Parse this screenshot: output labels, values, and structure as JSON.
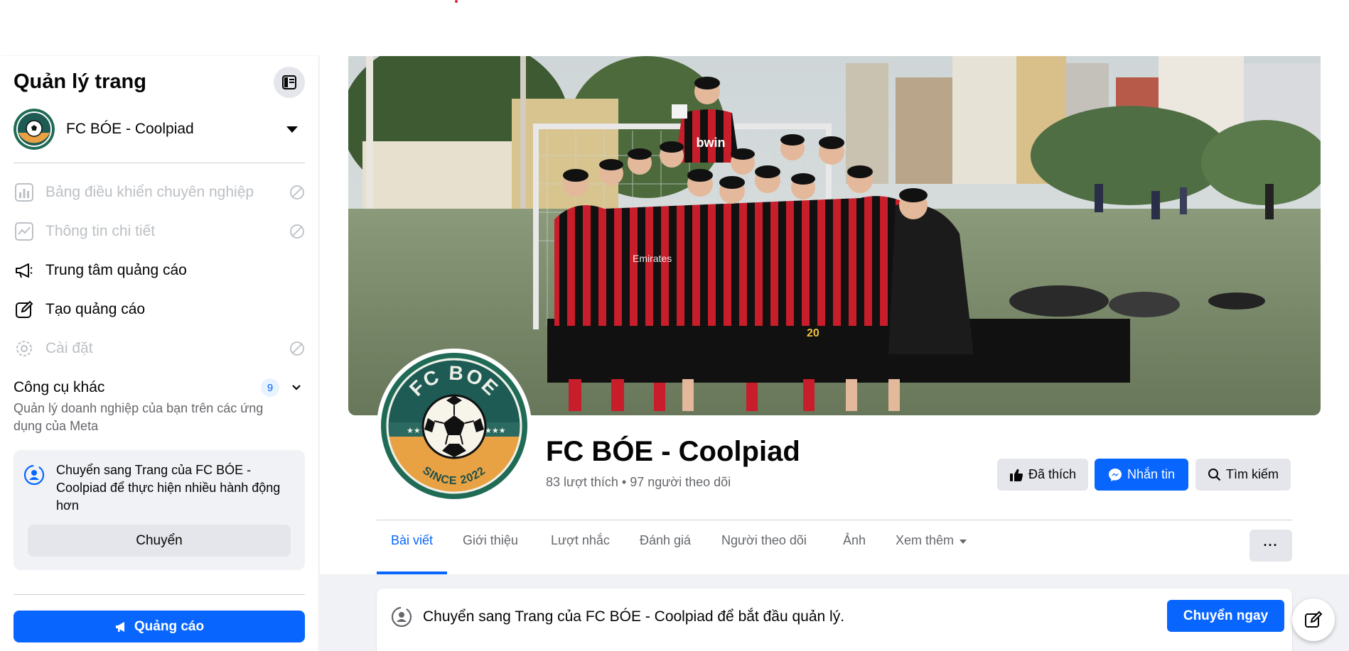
{
  "sidebar": {
    "title": "Quản lý trang",
    "page_name": "FC BÓE - Coolpiad",
    "menu": [
      {
        "label": "Bảng điều khiển chuyên nghiệp",
        "icon": "dashboard-icon",
        "disabled": true
      },
      {
        "label": "Thông tin chi tiết",
        "icon": "insights-icon",
        "disabled": true
      },
      {
        "label": "Trung tâm quảng cáo",
        "icon": "megaphone-icon",
        "disabled": false
      },
      {
        "label": "Tạo quảng cáo",
        "icon": "edit-icon",
        "disabled": false
      },
      {
        "label": "Cài đặt",
        "icon": "gear-icon",
        "disabled": true
      }
    ],
    "tools": {
      "title": "Công cụ khác",
      "badge": "9",
      "description": "Quản lý doanh nghiệp của bạn trên các ứng dụng của Meta"
    },
    "switch_card": {
      "text": "Chuyển sang Trang của FC BÓE - Coolpiad để thực hiện nhiều hành động hơn",
      "button": "Chuyển"
    },
    "ads_button": "Quảng cáo"
  },
  "profile": {
    "logo_top": "FC BOE",
    "logo_bottom": "SINCE 2022",
    "name": "FC BÓE - Coolpiad",
    "stats": "83 lượt thích • 97 người theo dõi",
    "buttons": {
      "liked": "Đã thích",
      "message": "Nhắn tin",
      "search": "Tìm kiếm"
    }
  },
  "cover": {
    "shirt_sponsor": "bwin",
    "shirt_text": "Emirates",
    "shirt_number": "20"
  },
  "tabs": [
    {
      "label": "Bài viết",
      "active": true
    },
    {
      "label": "Giới thiệu"
    },
    {
      "label": "Lượt nhắc"
    },
    {
      "label": "Đánh giá"
    },
    {
      "label": "Người theo dõi"
    },
    {
      "label": "Ảnh"
    },
    {
      "label": "Xem thêm",
      "dropdown": true
    }
  ],
  "more_button": "···",
  "banner": {
    "text": "Chuyển sang Trang của FC BÓE - Coolpiad để bắt đầu quản lý.",
    "button": "Chuyển ngay"
  },
  "colors": {
    "accent": "#0866ff",
    "disabled_text": "#bcc0c4",
    "secondary_text": "#65676b",
    "button_gray": "#e4e6eb",
    "background": "#f0f2f5",
    "logo_green": "#1f6b55",
    "logo_orange": "#e8a243"
  }
}
